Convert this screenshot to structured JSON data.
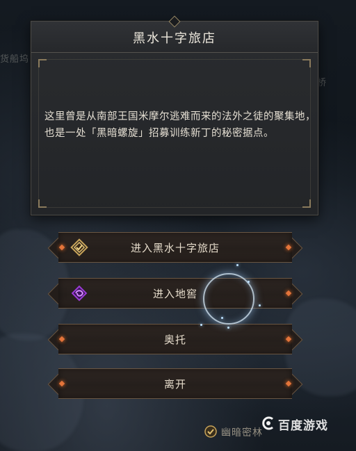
{
  "background": {
    "left_map_label": "货船坞",
    "right_map_label": "桥"
  },
  "dialog": {
    "title": "黑水十字旅店",
    "description": "这里曾是从南部王国米摩尔逃难而来的法外之徒的聚集地，也是一处「黑暗螺旋」招募训练新丁的秘密据点。"
  },
  "options": [
    {
      "label": "进入黑水十字旅店",
      "icon": "tavern-emblem-icon"
    },
    {
      "label": "进入地窖",
      "icon": "dark-spiral-icon"
    },
    {
      "label": "奥托",
      "icon": ""
    },
    {
      "label": "离开",
      "icon": ""
    }
  ],
  "footer": {
    "tracking_label": "幽暗密林",
    "watermark": "百度游戏"
  },
  "colors": {
    "accent_orange": "#e3743a",
    "button_border": "#6a5642",
    "panel_bg": "#2a2c2f",
    "text_light": "#e6dccb",
    "purple_icon": "#9b3bd6",
    "gold_icon": "#c9a55a"
  }
}
